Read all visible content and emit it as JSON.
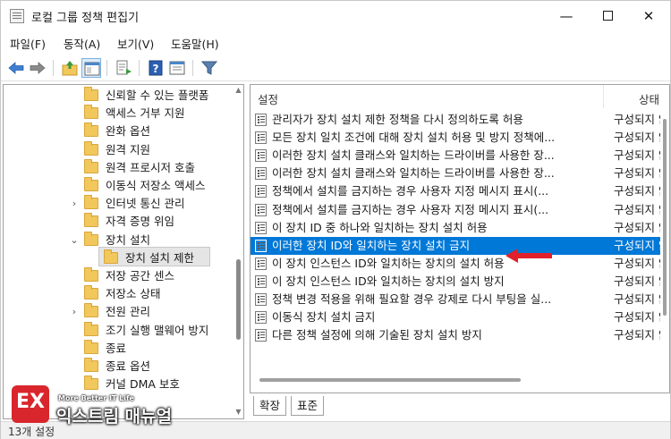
{
  "window": {
    "title": "로컬 그룹 정책 편집기"
  },
  "menu": [
    "파일(F)",
    "동작(A)",
    "보기(V)",
    "도움말(H)"
  ],
  "toolbar_icons": [
    "back-arrow-icon",
    "forward-arrow-icon",
    "up-folder-icon",
    "show-hide-tree-icon",
    "export-list-icon",
    "help-icon",
    "properties-icon",
    "filter-icon"
  ],
  "tree": [
    {
      "label": "신뢰할 수 있는 플랫폼",
      "expander": ""
    },
    {
      "label": "액세스 거부 지원",
      "expander": ""
    },
    {
      "label": "완화 옵션",
      "expander": ""
    },
    {
      "label": "원격 지원",
      "expander": ""
    },
    {
      "label": "원격 프로시저 호출",
      "expander": ""
    },
    {
      "label": "이동식 저장소 액세스",
      "expander": ""
    },
    {
      "label": "인터넷 통신 관리",
      "expander": "›"
    },
    {
      "label": "자격 증명 위임",
      "expander": ""
    },
    {
      "label": "장치 설치",
      "expander": "⌄"
    },
    {
      "label": "장치 설치 제한",
      "expander": "",
      "child": true
    },
    {
      "label": "저장 공간 센스",
      "expander": ""
    },
    {
      "label": "저장소 상태",
      "expander": ""
    },
    {
      "label": "전원 관리",
      "expander": "›"
    },
    {
      "label": "조기 실행 맬웨어 방지",
      "expander": ""
    },
    {
      "label": "종료",
      "expander": ""
    },
    {
      "label": "종료 옵션",
      "expander": ""
    },
    {
      "label": "커널 DMA 보호",
      "expander": ""
    }
  ],
  "list": {
    "col_setting": "설정",
    "col_state": "상태",
    "rows": [
      {
        "label": "관리자가 장치 설치 제한 정책을 다시 정의하도록 허용",
        "state": "구성되지 않음"
      },
      {
        "label": "모든 장치 일치 조건에 대해 장치 설치 허용 및 방지 정책에...",
        "state": "구성되지 않음"
      },
      {
        "label": "이러한 장치 설치 클래스와 일치하는 드라이버를 사용한 장...",
        "state": "구성되지 않음"
      },
      {
        "label": "이러한 장치 설치 클래스와 일치하는 드라이버를 사용한 장...",
        "state": "구성되지 않음"
      },
      {
        "label": "정책에서 설치를 금지하는 경우 사용자 지정 메시지 표시(...",
        "state": "구성되지 않음"
      },
      {
        "label": "정책에서 설치를 금지하는 경우 사용자 지정 메시지 표시(...",
        "state": "구성되지 않음"
      },
      {
        "label": "이 장치 ID 중 하나와 일치하는 장치 설치 허용",
        "state": "구성되지 않음"
      },
      {
        "label": "이러한 장치 ID와 일치하는 장치 설치 금지",
        "state": "구성되지 않음",
        "selected": true
      },
      {
        "label": "이 장치 인스턴스 ID와 일치하는 장치의 설치 허용",
        "state": "구성되지 않음"
      },
      {
        "label": "이 장치 인스턴스 ID와 일치하는 장치의 설치 방지",
        "state": "구성되지 않음"
      },
      {
        "label": "정책 변경 적용을 위해 필요할 경우 강제로 다시 부팅을 실...",
        "state": "구성되지 않음"
      },
      {
        "label": "이동식 장치 설치 금지",
        "state": "구성되지 않음"
      },
      {
        "label": "다른 정책 설정에 의해 기술된 장치 설치 방지",
        "state": "구성되지 않음"
      }
    ]
  },
  "tabs": [
    "확장",
    "표준"
  ],
  "status": "13개 설정",
  "watermark": {
    "logo_text": "EX",
    "tagline": "More Better IT Life",
    "name": "익스트림 매뉴얼"
  },
  "colors": {
    "selection": "#0078d7",
    "folder": "#f2c75b",
    "arrow": "#e0202a",
    "watermark": "#d9262c"
  }
}
